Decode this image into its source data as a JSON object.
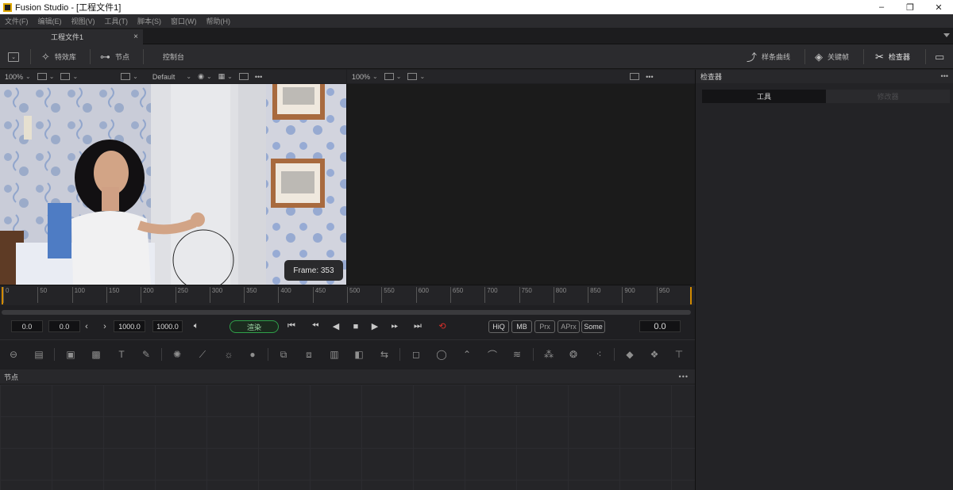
{
  "window": {
    "title": "Fusion Studio - [工程文件1]",
    "minimize": "–",
    "maximize": "❐",
    "close": "✕"
  },
  "menu": [
    "文件(F)",
    "编辑(E)",
    "视图(V)",
    "工具(T)",
    "脚本(S)",
    "窗口(W)",
    "帮助(H)"
  ],
  "doc_tab": {
    "label": "工程文件1",
    "close": "×"
  },
  "toolbar": {
    "effects_label": "特效库",
    "nodes_label": "节点",
    "console_label": "控制台",
    "spline_label": "样条曲线",
    "keyframes_label": "关键帧",
    "inspector_label": "检查器"
  },
  "viewer_bar_left": {
    "zoom": "100%",
    "lut": "Default"
  },
  "viewer_bar_right": {
    "zoom": "100%"
  },
  "viewer": {
    "frame_label": "Frame: 353"
  },
  "ruler": {
    "ticks": [
      "0",
      "50",
      "100",
      "150",
      "200",
      "250",
      "300",
      "350",
      "400",
      "450",
      "500",
      "550",
      "600",
      "650",
      "700",
      "750",
      "800",
      "850",
      "900",
      "950"
    ]
  },
  "transport": {
    "global_start": "0.0",
    "render_start": "0.0",
    "render_end": "1000.0",
    "global_end": "1000.0",
    "render_label": "渲染",
    "current_time": "0.0",
    "toggles": [
      "HiQ",
      "MB",
      "Prx",
      "APrx",
      "Some"
    ]
  },
  "nodes_panel": {
    "title": "节点",
    "more": "•••"
  },
  "inspector": {
    "title": "检查器",
    "more": "•••",
    "tab_tools": "工具",
    "tab_modifiers": "修改器"
  },
  "colors": {
    "accent_green": "#2fa04a",
    "loop_red": "#e0302a",
    "ruler_marker": "#d28a00"
  }
}
